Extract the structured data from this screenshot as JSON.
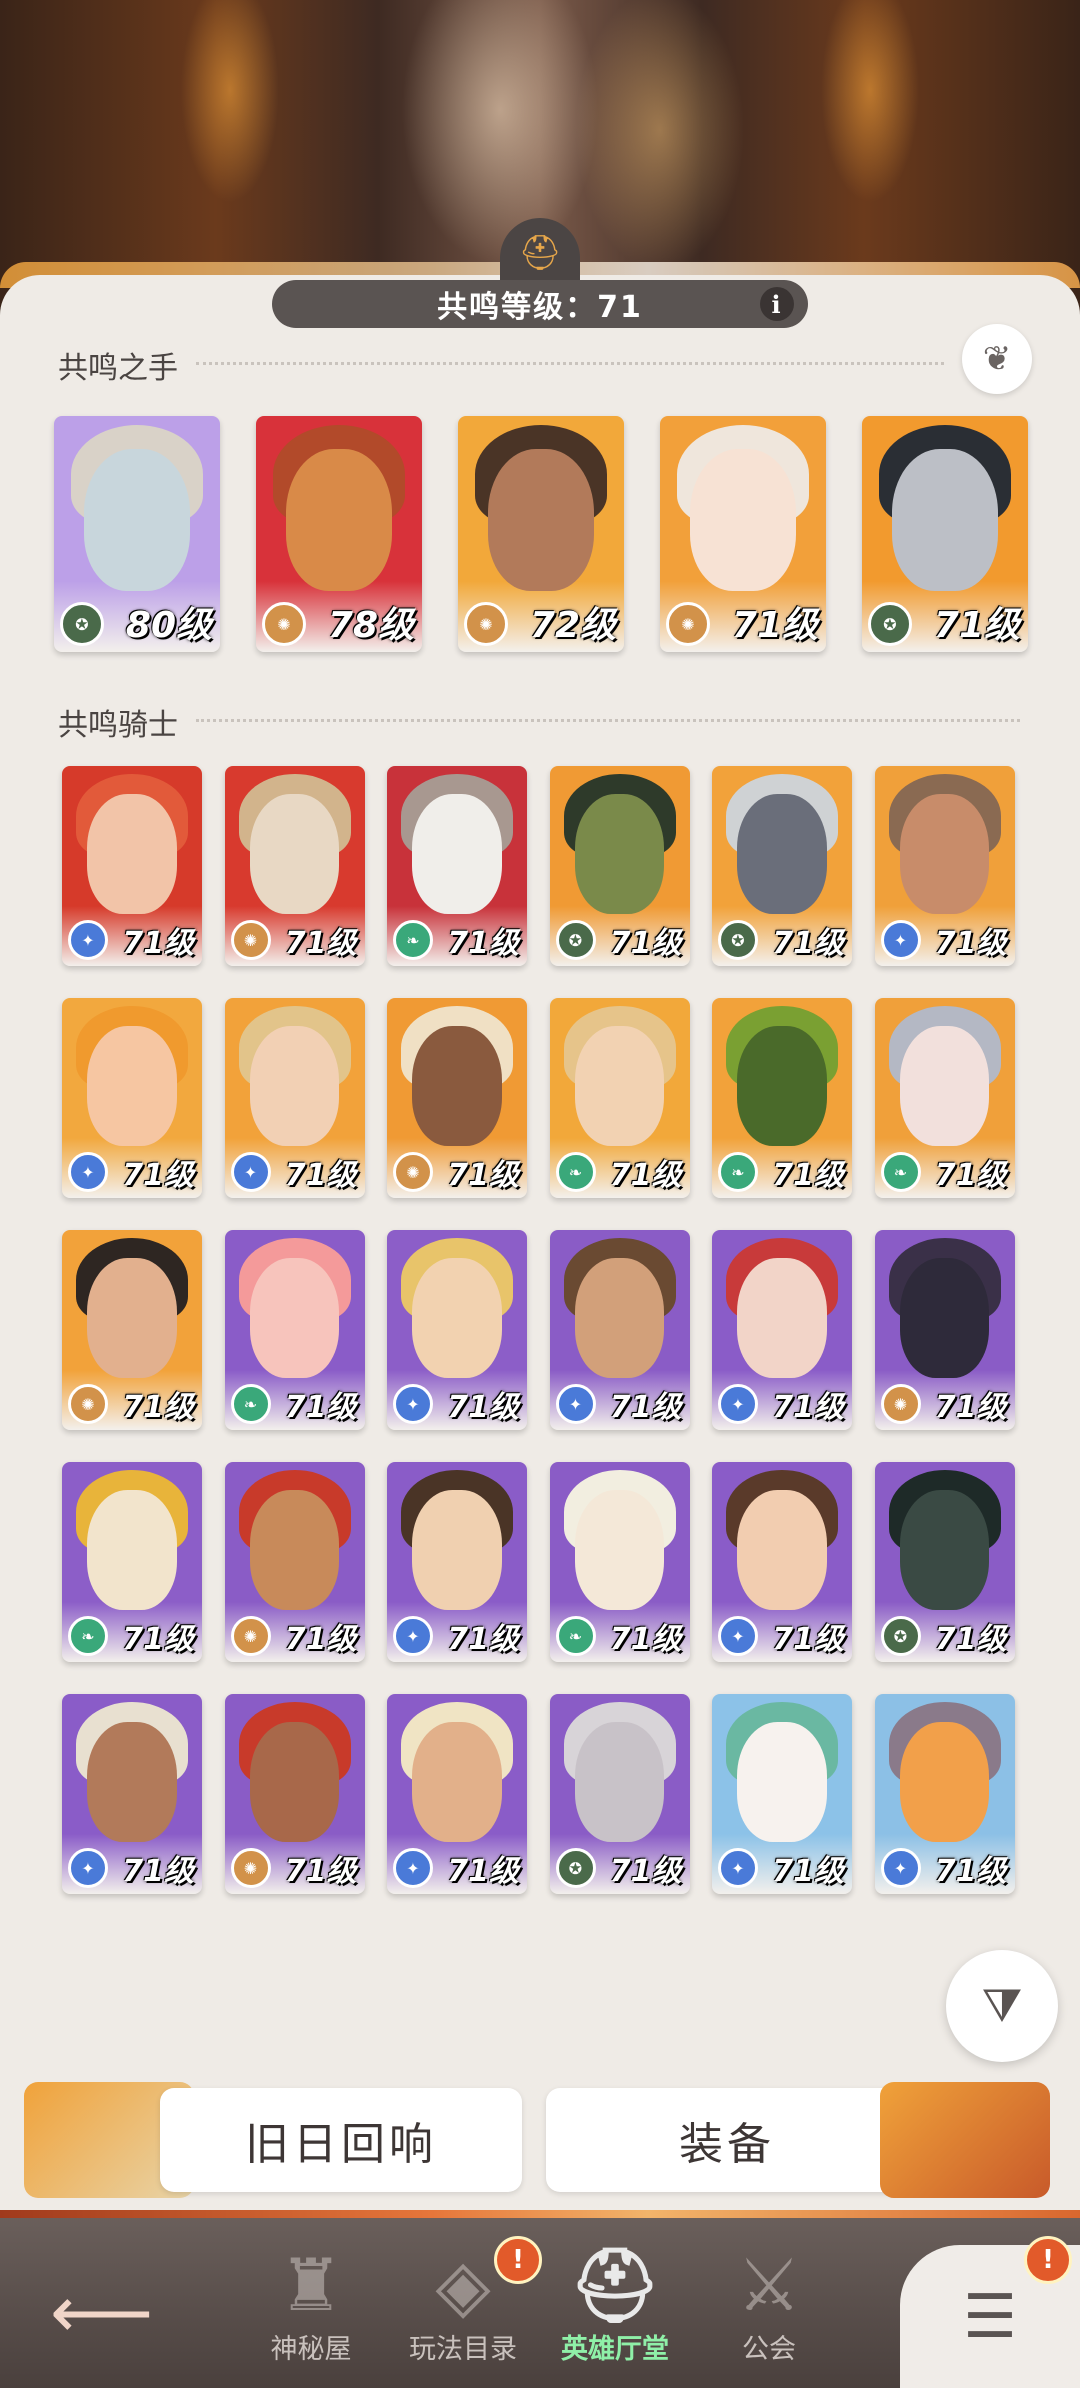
{
  "header": {
    "resonance_label": "共鸣等级：71",
    "info_icon": "i"
  },
  "sections": {
    "hands_title": "共鸣之手",
    "knights_title": "共鸣骑士"
  },
  "hands": [
    {
      "level": "80级",
      "badge": "star-ring",
      "bg": "#bca0e8",
      "face": "#c8d6dc",
      "hair": "#d9d2c8"
    },
    {
      "level": "78级",
      "badge": "flame",
      "bg": "#d8323a",
      "face": "#d98a48",
      "hair": "#b24a2a"
    },
    {
      "level": "72级",
      "badge": "flame",
      "bg": "#f2a83a",
      "face": "#b27a5a",
      "hair": "#4a3426"
    },
    {
      "level": "71级",
      "badge": "flame",
      "bg": "#f2a03a",
      "face": "#f7e2d4",
      "hair": "#efe6dc"
    },
    {
      "level": "71级",
      "badge": "star-ring",
      "bg": "#f29a2e",
      "face": "#bcbfc6",
      "hair": "#2a2e34"
    }
  ],
  "knights": [
    {
      "level": "71级",
      "badge": "star",
      "bg": "#d63a2a",
      "face": "#f2c4a8",
      "hair": "#e25a3a"
    },
    {
      "level": "71级",
      "badge": "flame",
      "bg": "#d83a2e",
      "face": "#e8d8c4",
      "hair": "#d2b48c"
    },
    {
      "level": "71级",
      "badge": "leaf",
      "bg": "#c8323a",
      "face": "#f0eeea",
      "hair": "#a89890"
    },
    {
      "level": "71级",
      "badge": "star-ring",
      "bg": "#f09a34",
      "face": "#7a8a4a",
      "hair": "#2e3a2a"
    },
    {
      "level": "71级",
      "badge": "star-ring",
      "bg": "#f2a23a",
      "face": "#6a6e7a",
      "hair": "#cfd2d4"
    },
    {
      "level": "71级",
      "badge": "star",
      "bg": "#f0a03a",
      "face": "#c88c6a",
      "hair": "#8a6a52"
    },
    {
      "level": "71级",
      "badge": "star",
      "bg": "#f2a83e",
      "face": "#f6c6a2",
      "hair": "#f09a2e"
    },
    {
      "level": "71级",
      "badge": "star",
      "bg": "#f2a23a",
      "face": "#f2d0b4",
      "hair": "#e2c48a"
    },
    {
      "level": "71级",
      "badge": "flame",
      "bg": "#f09a34",
      "face": "#8a5a3e",
      "hair": "#f0e0c4"
    },
    {
      "level": "71级",
      "badge": "leaf",
      "bg": "#f2a83a",
      "face": "#f2d2b2",
      "hair": "#e6c48a"
    },
    {
      "level": "71级",
      "badge": "leaf",
      "bg": "#f2a23a",
      "face": "#4a6a2a",
      "hair": "#7aa032"
    },
    {
      "level": "71级",
      "badge": "leaf",
      "bg": "#f0a03a",
      "face": "#f2e0dc",
      "hair": "#b4b8c4"
    },
    {
      "level": "71级",
      "badge": "flame",
      "bg": "#f2a23a",
      "face": "#e2b08e",
      "hair": "#2e2622"
    },
    {
      "level": "71级",
      "badge": "leaf",
      "bg": "#8a5cc8",
      "face": "#f7c4bc",
      "hair": "#f49a9a"
    },
    {
      "level": "71级",
      "badge": "star",
      "bg": "#8c5ec8",
      "face": "#f2d2b0",
      "hair": "#e8c46a"
    },
    {
      "level": "71级",
      "badge": "star",
      "bg": "#8a5cc6",
      "face": "#d2a07a",
      "hair": "#6a4a32"
    },
    {
      "level": "71级",
      "badge": "star",
      "bg": "#8a5cc8",
      "face": "#f2d4c8",
      "hair": "#c83a3a"
    },
    {
      "level": "71级",
      "badge": "flame",
      "bg": "#8a5cc6",
      "face": "#2e2a3a",
      "hair": "#3a3048"
    },
    {
      "level": "71级",
      "badge": "leaf",
      "bg": "#8c5ec8",
      "face": "#f2e4cc",
      "hair": "#e8b43a"
    },
    {
      "level": "71级",
      "badge": "flame",
      "bg": "#8a5cc6",
      "face": "#c88a5a",
      "hair": "#c83a2a"
    },
    {
      "level": "71级",
      "badge": "star",
      "bg": "#8a5cc8",
      "face": "#f0d0b0",
      "hair": "#4a3426"
    },
    {
      "level": "71级",
      "badge": "leaf",
      "bg": "#8a5cc6",
      "face": "#f4e8d8",
      "hair": "#f2eee0"
    },
    {
      "level": "71级",
      "badge": "star",
      "bg": "#8a5cc8",
      "face": "#f2cdb0",
      "hair": "#5a3a2a"
    },
    {
      "level": "71级",
      "badge": "star-ring",
      "bg": "#8a5cc6",
      "face": "#3a4a44",
      "hair": "#1e2a28"
    },
    {
      "level": "71级",
      "badge": "star",
      "bg": "#8a5cc8",
      "face": "#b27a5a",
      "hair": "#e8e0d0"
    },
    {
      "level": "71级",
      "badge": "flame",
      "bg": "#8a5cc6",
      "face": "#a8684a",
      "hair": "#c83a2a"
    },
    {
      "level": "71级",
      "badge": "star",
      "bg": "#8a5cc8",
      "face": "#e2b08a",
      "hair": "#f0e4c4"
    },
    {
      "level": "71级",
      "badge": "star-ring",
      "bg": "#8a5cc6",
      "face": "#c8c2c8",
      "hair": "#d8d4d8"
    },
    {
      "level": "71级",
      "badge": "star",
      "bg": "#8cc2e8",
      "face": "#f7f2ee",
      "hair": "#6ab8a2"
    },
    {
      "level": "71级",
      "badge": "star",
      "bg": "#8cc0e6",
      "face": "#f2a04a",
      "hair": "#8a7a8a"
    }
  ],
  "badge_colors": {
    "star": "#4a7ad8",
    "flame": "#d2924a",
    "leaf": "#3aa87a",
    "star-ring": "#4a6a4a"
  },
  "buttons": {
    "echo_label": "旧日回响",
    "equipment_label": "装备"
  },
  "nav": {
    "back_icon": "back-arrow-icon",
    "items": [
      {
        "label": "神秘屋",
        "icon": "castle-icon",
        "active": false
      },
      {
        "label": "玩法目录",
        "icon": "diamond-grid-icon",
        "active": false,
        "alert": "!"
      },
      {
        "label": "英雄厅堂",
        "icon": "helmet-icon",
        "active": true
      },
      {
        "label": "公会",
        "icon": "crossed-swords-icon",
        "active": false
      }
    ],
    "menu_alert": "!",
    "menu_icon": "menu-icon"
  }
}
